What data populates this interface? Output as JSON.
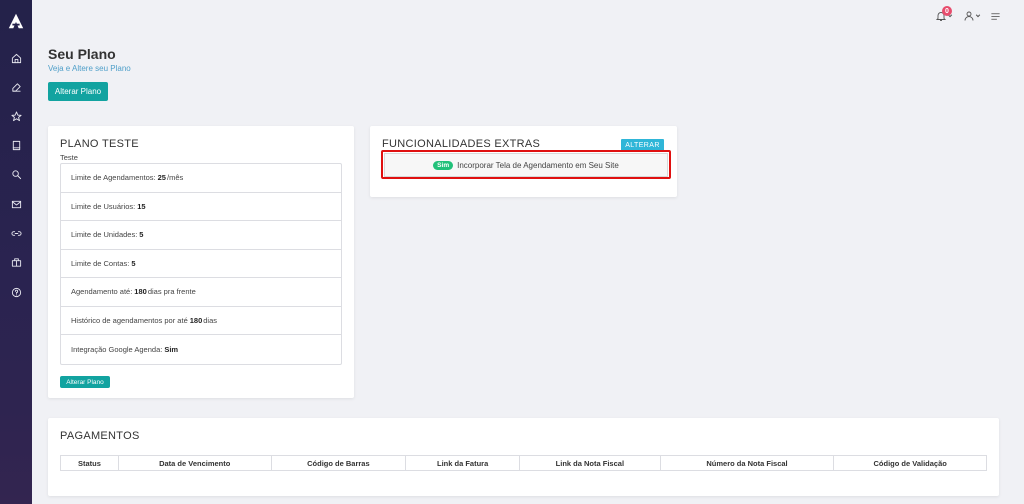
{
  "sidebar": {
    "items": [
      {
        "icon": "home-icon"
      },
      {
        "icon": "edit-icon"
      },
      {
        "icon": "star-icon"
      },
      {
        "icon": "book-icon"
      },
      {
        "icon": "search-icon"
      },
      {
        "icon": "mail-icon"
      },
      {
        "icon": "link-icon"
      },
      {
        "icon": "briefcase-icon"
      },
      {
        "icon": "help-icon"
      }
    ]
  },
  "topbar": {
    "notification_count": "0"
  },
  "header": {
    "title": "Seu Plano",
    "subtitle": "Veja e Altere seu Plano",
    "alterar_label": "Alterar Plano"
  },
  "plan": {
    "title": "PLANO TESTE",
    "subtitle": "Teste",
    "features": [
      {
        "label": "Limite de Agendamentos:",
        "value": "25",
        "suffix": "/mês"
      },
      {
        "label": "Limite de Usuários:",
        "value": "15",
        "suffix": ""
      },
      {
        "label": "Limite de Unidades:",
        "value": "5",
        "suffix": ""
      },
      {
        "label": "Limite de Contas:",
        "value": "5",
        "suffix": ""
      },
      {
        "label": "Agendamento até:",
        "value": "180",
        "suffix": "dias pra frente"
      },
      {
        "label": "Histórico de agendamentos por até",
        "value": "180",
        "suffix": "dias"
      },
      {
        "label": "Integração Google Agenda:",
        "value": "Sim",
        "suffix": ""
      }
    ],
    "alterar_label": "Alterar Plano"
  },
  "extras": {
    "title": "FUNCIONALIDADES EXTRAS",
    "alterar_label": "ALTERAR",
    "items": [
      {
        "status": "Sim",
        "label": "Incorporar Tela de Agendamento em Seu Site"
      }
    ]
  },
  "payments": {
    "title": "PAGAMENTOS",
    "columns": [
      "Status",
      "Data de Vencimento",
      "Código de Barras",
      "Link da Fatura",
      "Link da Nota Fiscal",
      "Número da Nota Fiscal",
      "Código de Validação"
    ]
  },
  "colors": {
    "accent": "#12a3a0",
    "highlight": "#e01010",
    "badge": "#e74c6c",
    "pill": "#22c17a"
  }
}
